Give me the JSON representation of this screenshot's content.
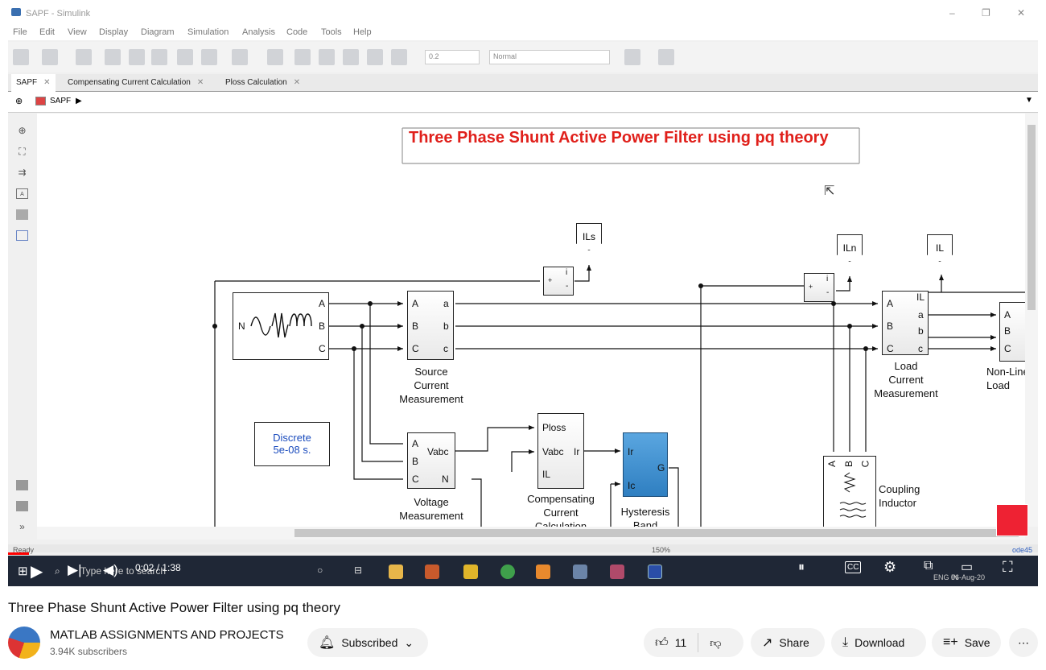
{
  "simulink": {
    "window_title": "SAPF - Simulink",
    "window_controls": [
      "–",
      "❐",
      "✕"
    ],
    "menu": [
      "File",
      "Edit",
      "View",
      "Display",
      "Diagram",
      "Simulation",
      "Analysis",
      "Code",
      "Tools",
      "Help"
    ],
    "stop_time": "0.2",
    "sim_mode": "Normal",
    "tabs": [
      {
        "label": "SAPF"
      },
      {
        "label": "Compensating Current Calculation"
      },
      {
        "label": "Ploss Calculation"
      }
    ],
    "breadcrumb": "SAPF",
    "model_title": "Three Phase Shunt Active Power Filter using pq theory",
    "status_ready": "Ready",
    "zoom": "150%",
    "solver": "ode45",
    "blocks": {
      "tags": [
        "ILs",
        "ILn",
        "IL"
      ],
      "source_ports": [
        "A",
        "B",
        "C",
        "N"
      ],
      "src_meas_ports": [
        "A",
        "B",
        "C",
        "a",
        "b",
        "c"
      ],
      "src_meas_label": "Source\nCurrent\nMeasurement",
      "load_meas_ports": [
        "A",
        "B",
        "C",
        "IL",
        "a",
        "b",
        "c"
      ],
      "load_meas_label": "Load\nCurrent\nMeasurement",
      "nonlinear_ports": [
        "A",
        "B",
        "C"
      ],
      "nonlinear_label": "Non-Linear\nLoad",
      "powergui": "Discrete\n5e-08 s.",
      "volt_meas_ports": [
        "A",
        "B",
        "C",
        "Vabc",
        "N"
      ],
      "volt_meas_label": "Voltage\nMeasurement",
      "comp_ports": [
        "Ploss",
        "Vabc",
        "IL",
        "Ir"
      ],
      "comp_label": "Compensating\nCurrent\nCalculation",
      "hyst_ports": [
        "Ir",
        "Ic",
        "G"
      ],
      "hyst_label": "Hysteresis\nBand",
      "inductor_ports": [
        "A",
        "B",
        "C"
      ],
      "inductor_label": "Coupling\nInductor",
      "sum_signs": [
        "+",
        "-",
        "i"
      ]
    }
  },
  "player": {
    "time": "0:02 / 1:38",
    "progress": 0.02,
    "search_placeholder": "Type here to search",
    "clock": "06-Aug-20",
    "tray_lang": "ENG IN"
  },
  "video": {
    "title": "Three Phase Shunt Active Power Filter using pq theory",
    "channel": "MATLAB ASSIGNMENTS AND PROJECTS",
    "subscribers": "3.94K subscribers",
    "subscribed_label": "Subscribed",
    "likes": "11",
    "share_label": "Share",
    "download_label": "Download",
    "save_label": "Save"
  },
  "colors": {
    "title_red": "#e0201b",
    "hyst_blue": "#2f7fc1",
    "powergui_blue": "#1a4bbd",
    "progress_red": "#ff0000"
  }
}
